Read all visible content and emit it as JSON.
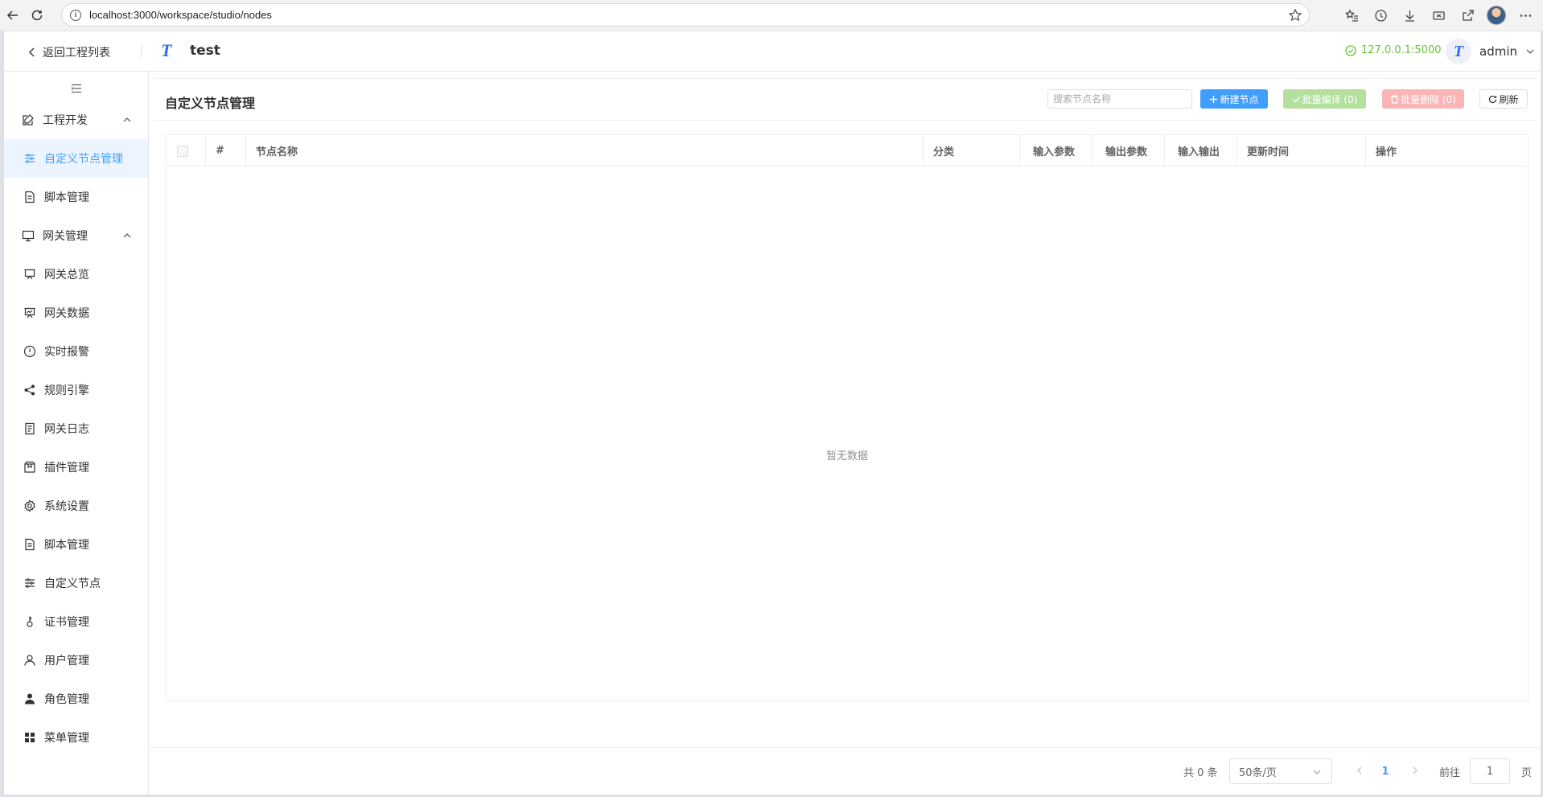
{
  "browser": {
    "url": "localhost:3000/workspace/studio/nodes"
  },
  "topbar": {
    "back_label": "返回工程列表",
    "logo_letter": "T",
    "project_name": "test",
    "server": "127.0.0.1:5000",
    "user_avatar_letter": "T",
    "user_name": "admin"
  },
  "sidebar": {
    "groups": [
      {
        "label": "工程开发",
        "expanded": true,
        "icon": "edit-icon"
      },
      {
        "label": "网关管理",
        "expanded": true,
        "icon": "monitor-icon"
      }
    ],
    "items": [
      {
        "label": "自定义节点管理",
        "icon": "sliders-icon",
        "active": true
      },
      {
        "label": "脚本管理",
        "icon": "document-icon"
      },
      {
        "label": "网关总览",
        "icon": "presentation-icon"
      },
      {
        "label": "网关数据",
        "icon": "chart-board-icon"
      },
      {
        "label": "实时报警",
        "icon": "warning-circle-icon"
      },
      {
        "label": "规则引擎",
        "icon": "share-icon"
      },
      {
        "label": "网关日志",
        "icon": "log-icon"
      },
      {
        "label": "插件管理",
        "icon": "box-icon"
      },
      {
        "label": "系统设置",
        "icon": "gear-icon"
      },
      {
        "label": "脚本管理",
        "icon": "document-icon"
      },
      {
        "label": "自定义节点",
        "icon": "sliders-icon"
      },
      {
        "label": "证书管理",
        "icon": "key-icon"
      },
      {
        "label": "用户管理",
        "icon": "user-icon"
      },
      {
        "label": "角色管理",
        "icon": "user-filled-icon"
      },
      {
        "label": "菜单管理",
        "icon": "grid-icon"
      }
    ]
  },
  "main": {
    "title": "自定义节点管理",
    "search_placeholder": "搜索节点名称",
    "buttons": {
      "new": "新建节点",
      "compile": "批量编译 (0)",
      "delete": "批量删除 (0)",
      "refresh": "刷新"
    },
    "table": {
      "columns": [
        "#",
        "节点名称",
        "分类",
        "输入参数",
        "输出参数",
        "输入输出",
        "更新时间",
        "操作"
      ],
      "rows": [],
      "empty_text": "暂无数据"
    },
    "pagination": {
      "total": "共 0 条",
      "page_size": "50条/页",
      "current_page": "1",
      "goto_label": "前往",
      "goto_value": "1",
      "page_unit": "页"
    }
  },
  "colors": {
    "primary": "#409eff",
    "success": "#67c23a",
    "success_disabled": "#b3e19d",
    "danger_disabled": "#fab6b6",
    "active_bg": "#ecf5ff"
  }
}
